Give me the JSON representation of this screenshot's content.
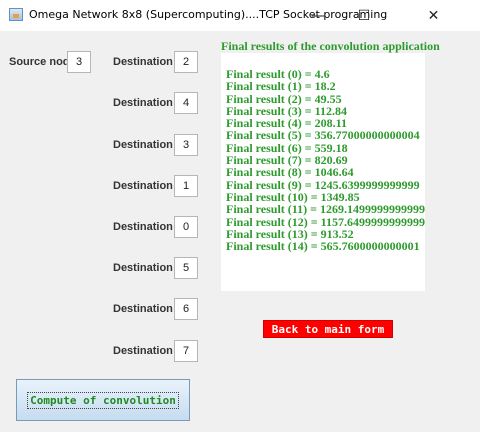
{
  "window": {
    "title": "Omega Network 8x8 (Supercomputing)....TCP Socket programing",
    "minimize_glyph": "—",
    "maximize_glyph": "☐",
    "close_glyph": "✕"
  },
  "source": {
    "label": "Source node :",
    "value": "3"
  },
  "destinations": [
    {
      "label": "Destination :",
      "value": "2"
    },
    {
      "label": "Destination :",
      "value": "4"
    },
    {
      "label": "Destination :",
      "value": "3"
    },
    {
      "label": "Destination :",
      "value": "1"
    },
    {
      "label": "Destination :",
      "value": "0"
    },
    {
      "label": "Destination :",
      "value": "5"
    },
    {
      "label": "Destination :",
      "value": "6"
    },
    {
      "label": "Destination :",
      "value": "7"
    }
  ],
  "results": {
    "title": "Final results of the convolution application",
    "items": [
      "Final result (0) = 4.6",
      "Final result (1) = 18.2",
      "Final result (2) = 49.55",
      "Final result (3) = 112.84",
      "Final result (4) = 208.11",
      "Final result (5) = 356.77000000000004",
      "Final result (6) = 559.18",
      "Final result (7) = 820.69",
      "Final result (8) = 1046.64",
      "Final result (9) = 1245.6399999999999",
      "Final result (10) = 1349.85",
      "Final result (11) = 1269.1499999999999",
      "Final result (12) = 1157.6499999999999",
      "Final result (13) = 913.52",
      "Final result (14) = 565.7600000000001"
    ]
  },
  "buttons": {
    "back": "Back to main form",
    "compute": "Compute of convolution"
  },
  "colors": {
    "result_text": "#2e9b2e",
    "back_button": "#ff0000",
    "window_bg": "#f0f0f0"
  }
}
